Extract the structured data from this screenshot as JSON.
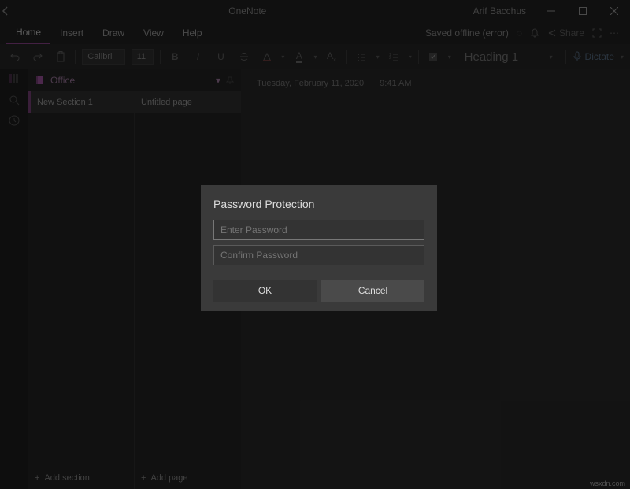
{
  "titlebar": {
    "app_title": "OneNote",
    "user_name": "Arif Bacchus"
  },
  "menu": {
    "items": [
      "Home",
      "Insert",
      "Draw",
      "View",
      "Help"
    ],
    "active_index": 0,
    "sync_status": "Saved offline (error)",
    "share_label": "Share"
  },
  "ribbon": {
    "font_name": "Calibri",
    "font_size": "11",
    "style_label": "Heading 1",
    "dictate_label": "Dictate"
  },
  "notebook": {
    "name": "Office",
    "section": "New Section 1",
    "page": "Untitled page",
    "add_section_label": "Add section",
    "add_page_label": "Add page"
  },
  "canvas": {
    "date": "Tuesday, February 11, 2020",
    "time": "9:41 AM"
  },
  "dialog": {
    "title": "Password Protection",
    "placeholder_password": "Enter Password",
    "placeholder_confirm": "Confirm Password",
    "ok_label": "OK",
    "cancel_label": "Cancel"
  },
  "watermark": "wsxdn.com"
}
